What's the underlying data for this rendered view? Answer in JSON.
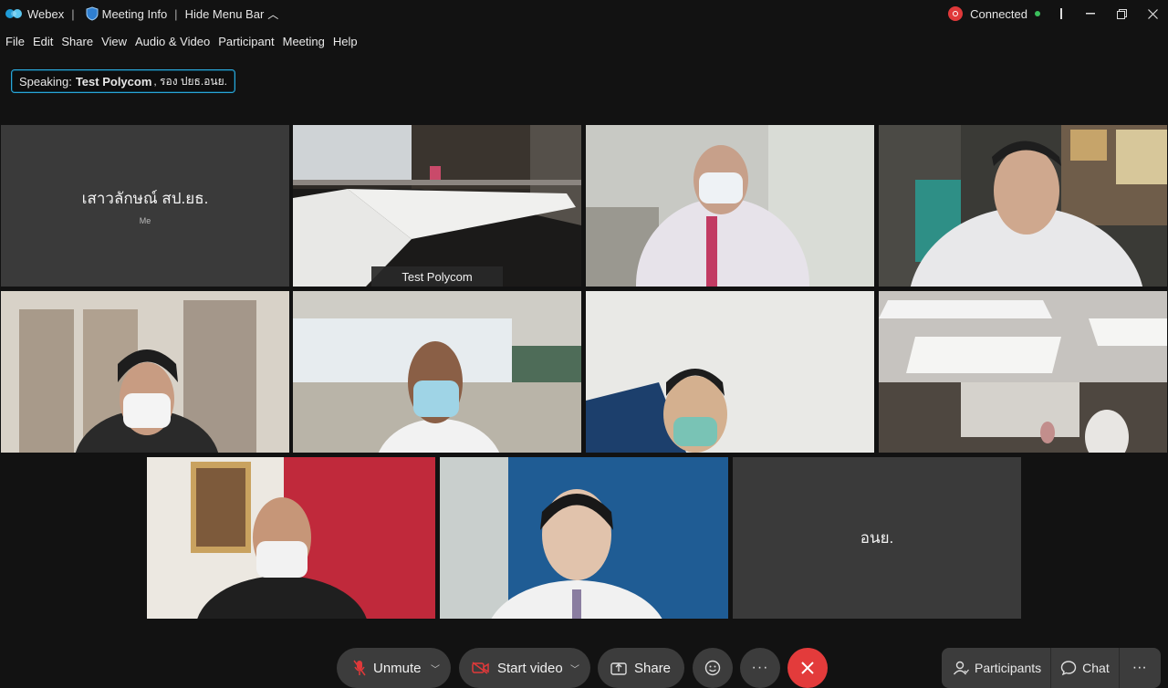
{
  "titlebar": {
    "app_name": "Webex",
    "meeting_info": "Meeting Info",
    "hide_menu": "Hide Menu Bar",
    "status": "Connected",
    "colors": {
      "accent": "#28b2e2",
      "record": "#e0393a",
      "connected": "#3bbf5c"
    }
  },
  "menu": {
    "items": [
      "File",
      "Edit",
      "Share",
      "View",
      "Audio & Video",
      "Participant",
      "Meeting",
      "Help"
    ]
  },
  "speaking": {
    "prefix": "Speaking:",
    "name": "Test Polycom",
    "role": ", รอง ปยธ.อนย."
  },
  "participants": {
    "self_name": "เสาวลักษณ์ สป.ยธ.",
    "self_tag": "Me",
    "active_name": "Test Polycom",
    "last_name": "อนย."
  },
  "controls": {
    "unmute": "Unmute",
    "start_video": "Start video",
    "share": "Share",
    "participants": "Participants",
    "chat": "Chat",
    "more": "···"
  }
}
